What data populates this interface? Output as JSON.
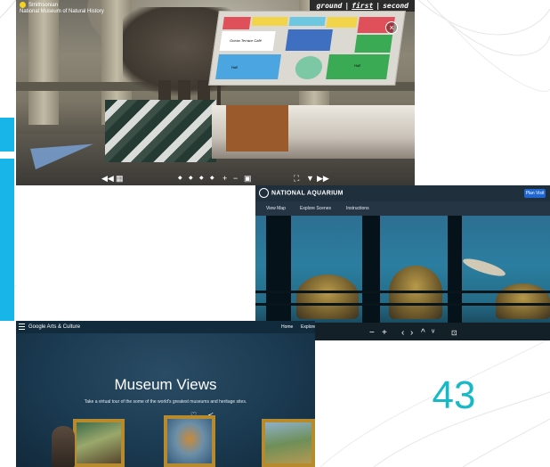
{
  "slide": {
    "page_number": "43",
    "accent_color": "#18b5e8",
    "number_color": "#17b9c6"
  },
  "smithsonian_tour": {
    "title_line1": "Smithsonian",
    "title_line2": "National Museum of Natural History",
    "floor_tabs": [
      "ground",
      "first",
      "second"
    ],
    "active_floor": "first",
    "floorplan_labels": [
      "Ocean Terrace Café",
      "Hall",
      "Hall"
    ],
    "close_icon": "close-icon",
    "controls_left": [
      "◀◀",
      "▦"
    ],
    "controls_center": [
      "◆",
      "◆",
      "◆",
      "◆",
      "+",
      "−",
      "▣"
    ],
    "controls_right": [
      "⛶",
      "▼",
      "▶▶"
    ]
  },
  "aquarium_tour": {
    "logo": "NATIONAL AQUARIUM",
    "button_primary": "Plan Visit",
    "menu": [
      "View Map",
      "Explore Scenes",
      "Instructions"
    ],
    "controls": [
      "−",
      "+",
      "‹",
      "›",
      "^",
      "ᵛ",
      "⊡"
    ]
  },
  "arts_culture": {
    "logo": "Google Arts & Culture",
    "nav": [
      "Home",
      "Explore"
    ],
    "title": "Museum Views",
    "subtitle": "Take a virtual tour of the some of the world's greatest museums and heritage sites.",
    "icons": [
      "heart-icon",
      "share-icon"
    ]
  }
}
